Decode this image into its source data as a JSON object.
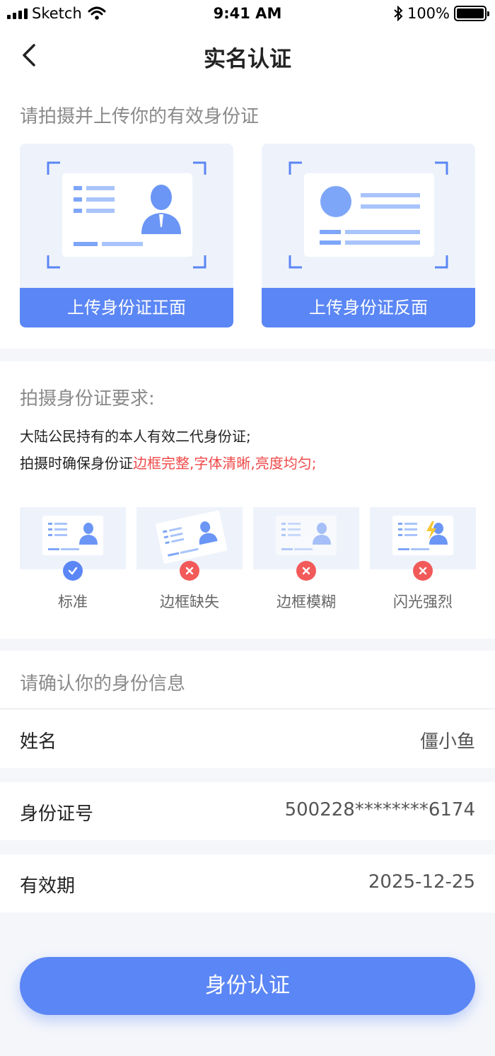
{
  "status_bar": {
    "carrier": "Sketch",
    "time": "9:41 AM",
    "battery": "100%"
  },
  "nav": {
    "title": "实名认证"
  },
  "upload": {
    "hint": "请拍摄并上传你的有效身份证",
    "front_label": "上传身份证正面",
    "back_label": "上传身份证反面"
  },
  "requirements": {
    "title": "拍摄身份证要求:",
    "line1": "大陆公民持有的本人有效二代身份证;",
    "line2_prefix": "拍摄时确保身份证",
    "line2_highlight": "边框完整,字体清晰,亮度均匀;",
    "samples": [
      {
        "label": "标准",
        "status": "ok"
      },
      {
        "label": "边框缺失",
        "status": "bad"
      },
      {
        "label": "边框模糊",
        "status": "bad"
      },
      {
        "label": "闪光强烈",
        "status": "bad"
      }
    ]
  },
  "confirm": {
    "hint": "请确认你的身份信息",
    "name_label": "姓名",
    "name_value": "僵小鱼",
    "id_label": "身份证号",
    "id_value": "500228********6174",
    "expiry_label": "有效期",
    "expiry_value": "2025-12-25"
  },
  "submit_label": "身份认证",
  "colors": {
    "accent": "#5b86f5",
    "error": "#f25a5a"
  }
}
